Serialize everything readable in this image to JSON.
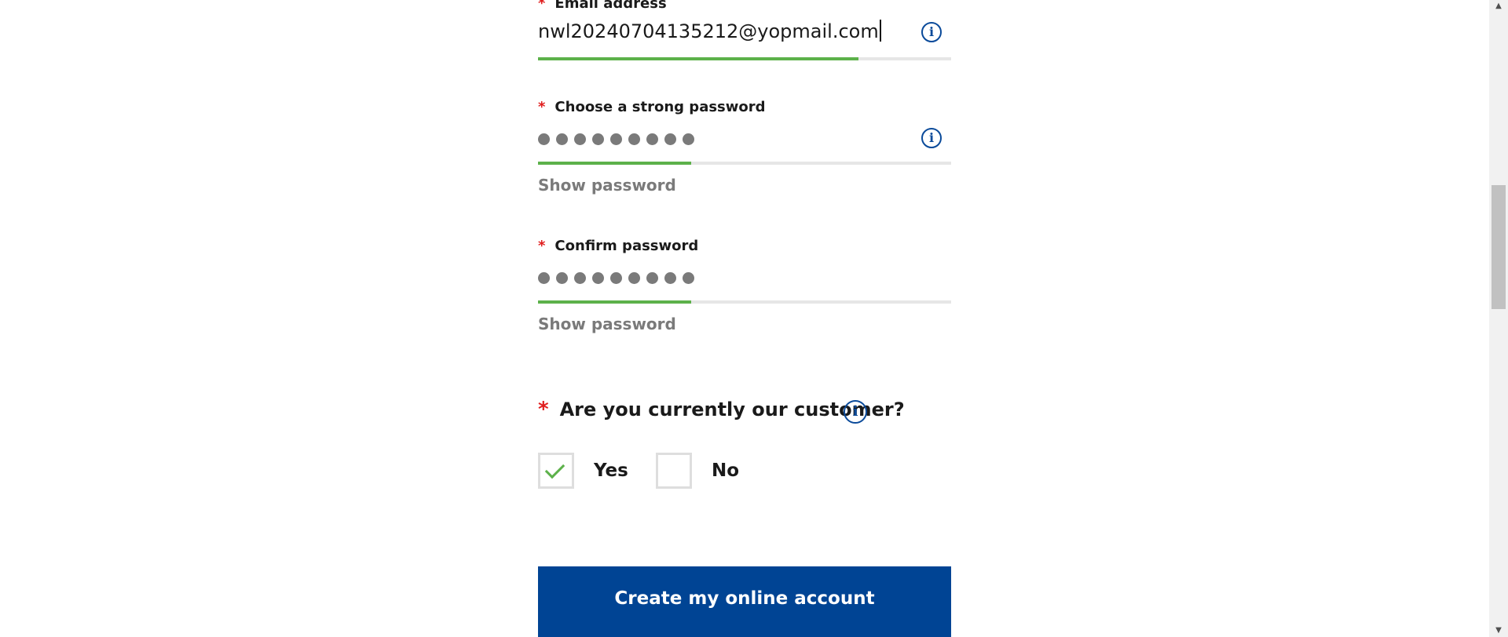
{
  "email": {
    "label": "Email address",
    "required_mark": "*",
    "value": "nwl20240704135212@yopmail.com",
    "strength_fraction": 0.776,
    "info_icon": "info-icon"
  },
  "password": {
    "label": "Choose a strong password",
    "required_mark": "*",
    "masked_length": 9,
    "strength_fraction": 0.37,
    "show_label": "Show password",
    "info_icon": "info-icon"
  },
  "confirm_password": {
    "label": "Confirm password",
    "required_mark": "*",
    "masked_length": 9,
    "strength_fraction": 0.37,
    "show_label": "Show password"
  },
  "customer_question": {
    "required_mark": "*",
    "text": "Are you currently our customer?",
    "info_icon": "info-icon",
    "options": [
      {
        "label": "Yes",
        "checked": true
      },
      {
        "label": "No",
        "checked": false
      }
    ]
  },
  "submit": {
    "label": "Create my online account"
  },
  "colors": {
    "accent_green": "#5cb14a",
    "primary_blue": "#004494",
    "required_red": "#e01e1e"
  }
}
